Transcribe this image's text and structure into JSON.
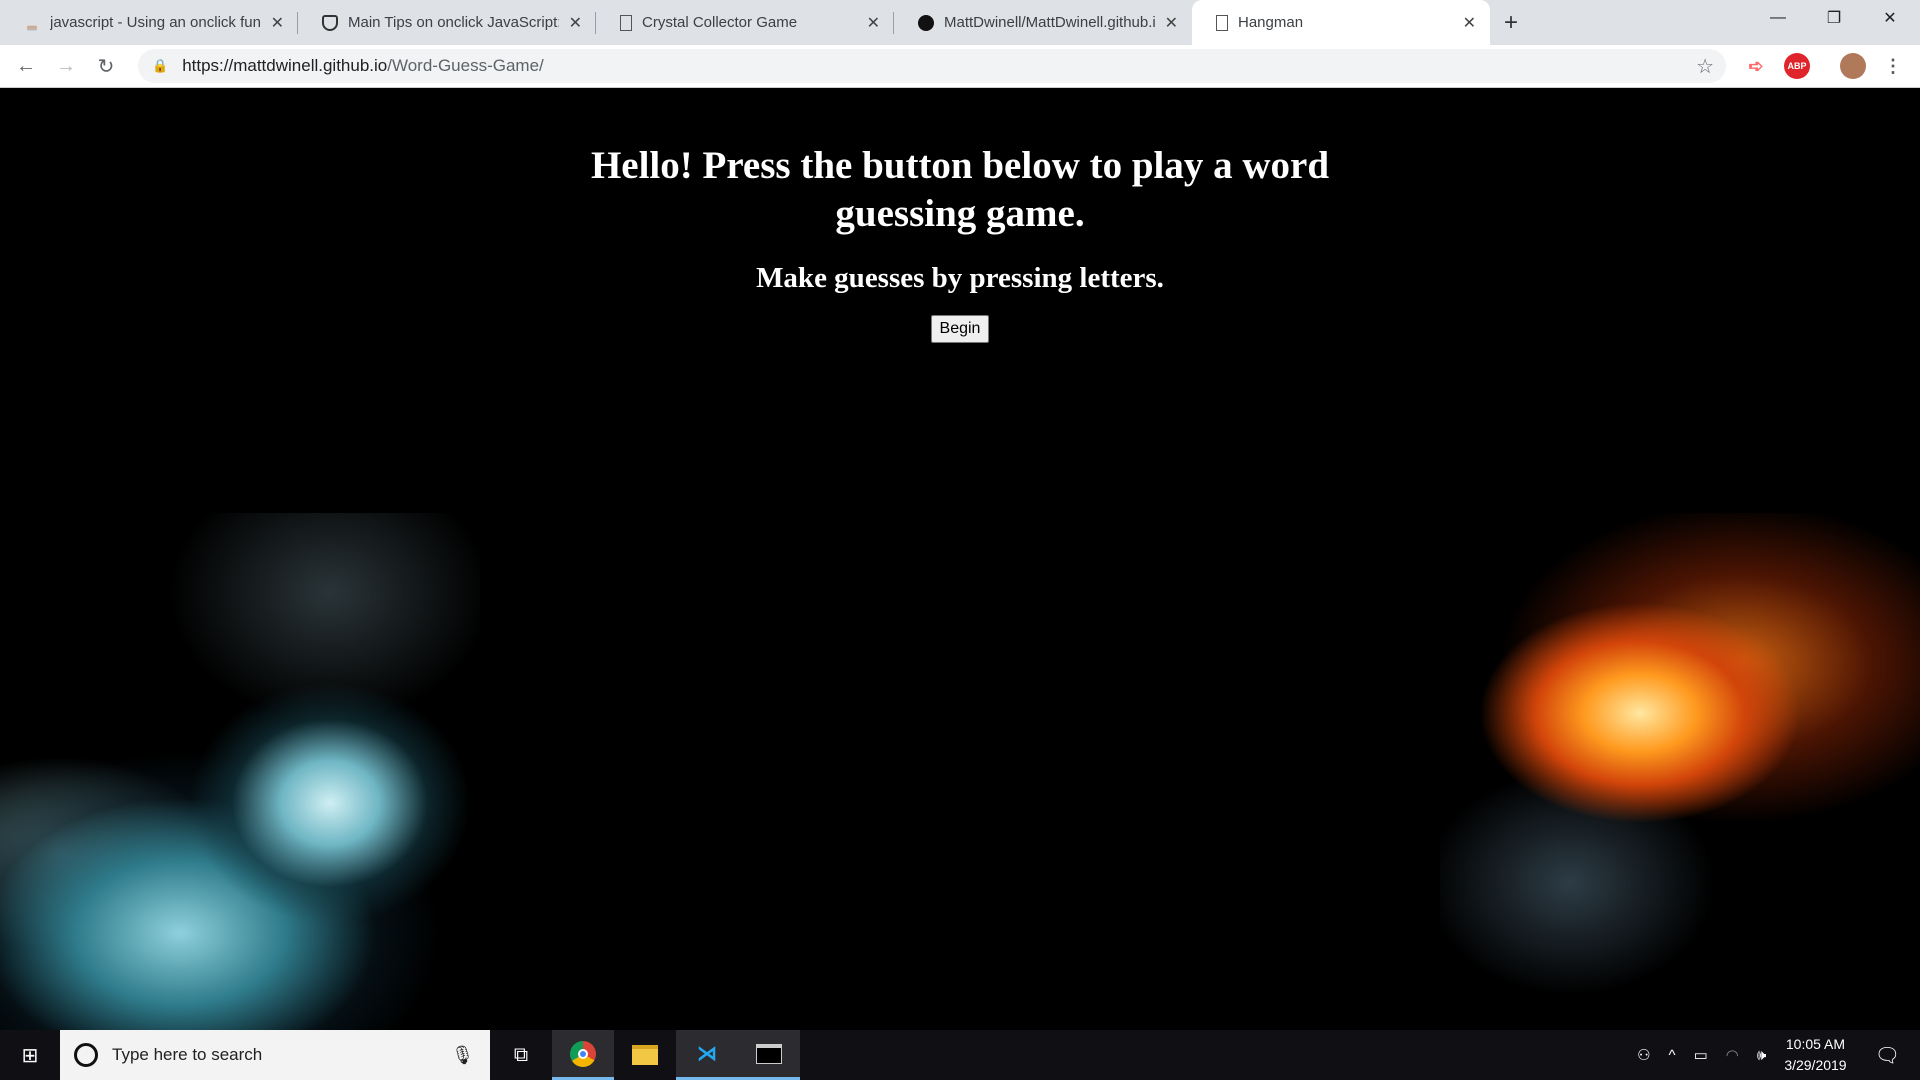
{
  "browser": {
    "tabs": [
      {
        "title": "javascript - Using an onclick func",
        "icon": "stackoverflow-icon"
      },
      {
        "title": "Main Tips on onclick JavaScript: H",
        "icon": "shield-icon"
      },
      {
        "title": "Crystal Collector Game",
        "icon": "page-icon"
      },
      {
        "title": "MattDwinell/MattDwinell.github.i",
        "icon": "github-icon"
      },
      {
        "title": "Hangman",
        "icon": "page-icon",
        "active": true
      }
    ],
    "url_host": "https://mattdwinell.github.io",
    "url_path": "/Word-Guess-Game/",
    "ext_abp": "ABP"
  },
  "page": {
    "heading": "Hello! Press the button below to play a word guessing game.",
    "subheading": "Make guesses by pressing letters.",
    "begin_label": "Begin"
  },
  "taskbar": {
    "search_placeholder": "Type here to search",
    "time": "10:05 AM",
    "date": "3/29/2019"
  }
}
